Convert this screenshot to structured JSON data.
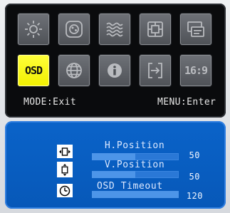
{
  "menu": {
    "tiles_row1": [
      {
        "icon": "brightness-icon"
      },
      {
        "icon": "color-icon"
      },
      {
        "icon": "noise-reduction-icon"
      },
      {
        "icon": "picture-adjust-icon"
      },
      {
        "icon": "input-source-icon"
      }
    ],
    "tiles_row2": [
      {
        "icon": "osd-icon",
        "text": "OSD",
        "selected": true
      },
      {
        "icon": "language-globe-icon"
      },
      {
        "icon": "information-icon"
      },
      {
        "icon": "reset-icon"
      },
      {
        "icon": "aspect-ratio-icon",
        "text": "16:9"
      }
    ],
    "hint_left": "MODE:Exit",
    "hint_right": "MENU:Enter"
  },
  "osd_settings": {
    "items": [
      {
        "label": "H.Position",
        "value": "50",
        "level": 0.5,
        "icon": "horizontal-position-icon"
      },
      {
        "label": "V.Position",
        "value": "50",
        "level": 0.5,
        "icon": "vertical-position-icon"
      },
      {
        "label": "OSD Timeout",
        "value": "120",
        "level": 1.0,
        "icon": "timer-clock-icon"
      }
    ]
  },
  "colors": {
    "selected_tile": "#f2f000",
    "panel_dark": "#0a0b0d",
    "panel_blue": "#0758b8"
  }
}
